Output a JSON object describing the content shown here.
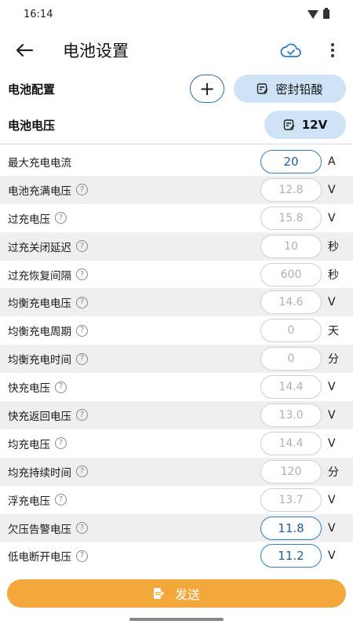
{
  "status": {
    "time": "16:14",
    "icons": [
      "wifi-icon",
      "battery-icon"
    ]
  },
  "app_bar": {
    "title": "电池设置",
    "back_icon": "arrow-left-icon",
    "cloud_icon": "cloud-check-icon",
    "more_icon": "more-vertical-icon"
  },
  "battery_config": {
    "label": "电池配置",
    "add_label": "+",
    "type_label": "密封铅酸"
  },
  "battery_voltage": {
    "label": "电池电压",
    "value": "12V"
  },
  "params": [
    {
      "label": "最大充电电流",
      "value": "20",
      "unit": "A",
      "help": false,
      "active": true
    },
    {
      "label": "电池充满电压",
      "value": "12.8",
      "unit": "V",
      "help": true,
      "active": false
    },
    {
      "label": "过充电压",
      "value": "15.8",
      "unit": "V",
      "help": true,
      "active": false
    },
    {
      "label": "过充关闭延迟",
      "value": "10",
      "unit": "秒",
      "help": true,
      "active": false
    },
    {
      "label": "过充恢复间隔",
      "value": "600",
      "unit": "秒",
      "help": true,
      "active": false
    },
    {
      "label": "均衡充电电压",
      "value": "14.6",
      "unit": "V",
      "help": true,
      "active": false
    },
    {
      "label": "均衡充电周期",
      "value": "0",
      "unit": "天",
      "help": true,
      "active": false
    },
    {
      "label": "均衡充电时间",
      "value": "0",
      "unit": "分",
      "help": true,
      "active": false
    },
    {
      "label": "快充电压",
      "value": "14.4",
      "unit": "V",
      "help": true,
      "active": false
    },
    {
      "label": "快充返回电压",
      "value": "13.0",
      "unit": "V",
      "help": true,
      "active": false
    },
    {
      "label": "均充电压",
      "value": "14.4",
      "unit": "V",
      "help": true,
      "active": false
    },
    {
      "label": "均充持续时间",
      "value": "120",
      "unit": "分",
      "help": true,
      "active": false
    },
    {
      "label": "浮充电压",
      "value": "13.7",
      "unit": "V",
      "help": true,
      "active": false
    },
    {
      "label": "欠压告警电压",
      "value": "11.8",
      "unit": "V",
      "help": true,
      "active": true
    },
    {
      "label": "低电断开电压",
      "value": "11.2",
      "unit": "V",
      "help": true,
      "active": true
    }
  ],
  "send_button": {
    "label": "发送"
  },
  "colors": {
    "accent": "#2a7fc4",
    "pill": "#cfe3f6",
    "send": "#f4a83c",
    "row_alt": "#efefef"
  }
}
